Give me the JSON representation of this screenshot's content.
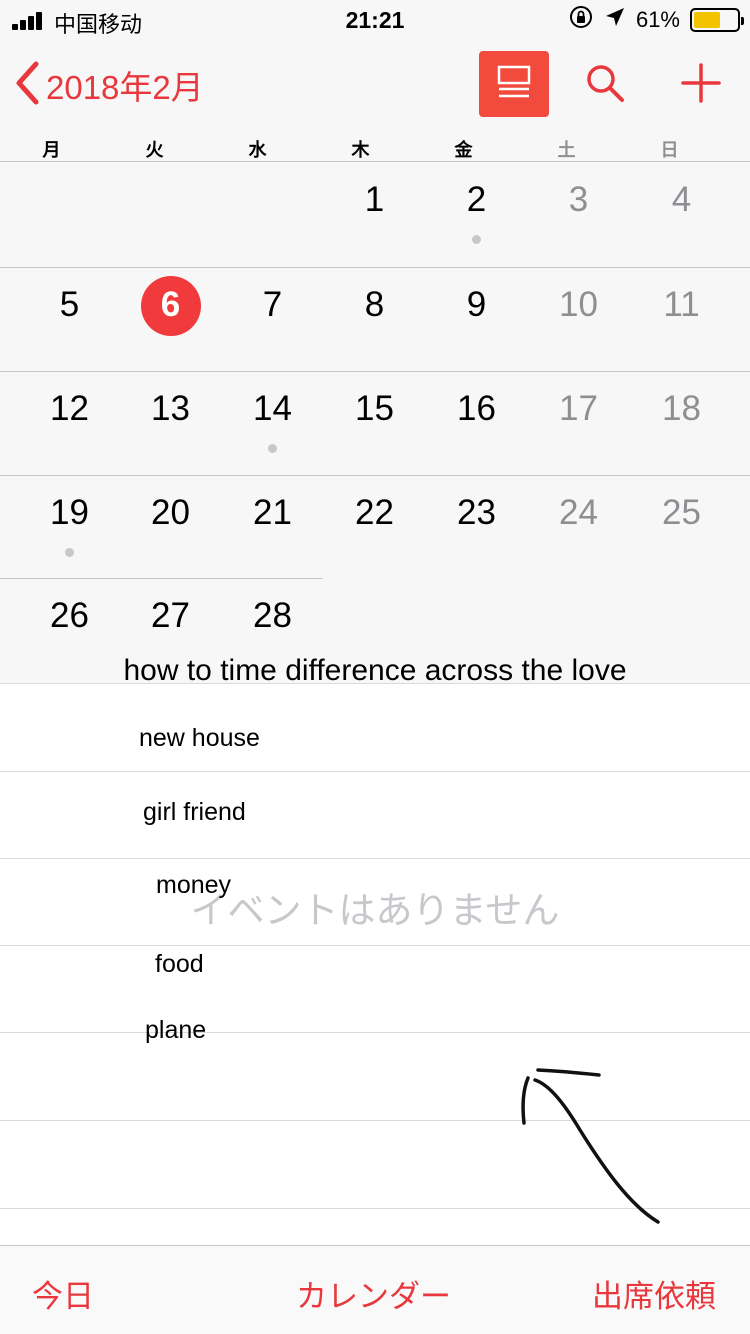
{
  "status_bar": {
    "carrier": "中国移动",
    "time": "21:21",
    "battery_percent": "61%",
    "battery_level": 0.61,
    "battery_color": "#f4c300"
  },
  "nav": {
    "back_icon": "chevron-left-icon",
    "title": "2018年2月",
    "buttons": [
      "list-view-icon",
      "search-icon",
      "add-icon"
    ],
    "accent_color": "#e8383d"
  },
  "weekdays": [
    "月",
    "火",
    "水",
    "木",
    "金",
    "土",
    "日"
  ],
  "calendar": {
    "weeks": [
      [
        null,
        null,
        null,
        "1",
        "2",
        "3",
        "4"
      ],
      [
        "5",
        "6",
        "7",
        "8",
        "9",
        "10",
        "11"
      ],
      [
        "12",
        "13",
        "14",
        "15",
        "16",
        "17",
        "18"
      ],
      [
        "19",
        "20",
        "21",
        "22",
        "23",
        "24",
        "25"
      ],
      [
        "26",
        "27",
        "28"
      ]
    ],
    "today": "6",
    "days_with_events": [
      "2",
      "14",
      "19"
    ]
  },
  "overlay": {
    "title": "how to time difference across the love",
    "items": [
      "new house",
      "girl friend",
      "money",
      "food",
      "plane"
    ]
  },
  "event_list": {
    "empty_text": "イベントはありません"
  },
  "tabbar": {
    "today": "今日",
    "calendars": "カレンダー",
    "inbox": "出席依頼"
  }
}
